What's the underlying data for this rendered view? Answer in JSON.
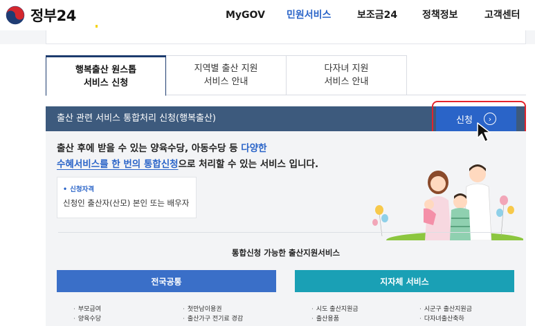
{
  "header": {
    "logo_text": "정부24",
    "nav": [
      "MyGOV",
      "민원서비스",
      "보조금24",
      "정책정보",
      "고객센터"
    ],
    "active_nav": "민원서비스"
  },
  "tabs": [
    {
      "line1": "행복출산 원스톱",
      "line2": "서비스 신청",
      "active": true
    },
    {
      "line1": "지역별 출산 지원",
      "line2": "서비스 안내",
      "active": false
    },
    {
      "line1": "다자녀 지원",
      "line2": "서비스 안내",
      "active": false
    }
  ],
  "service": {
    "title": "출산 관련 서비스 통합처리 신청(행복출산)",
    "apply_label": "신청",
    "lead": {
      "p1": "출산 후에 받을 수 있는 양육수당, 아동수당 등 ",
      "p1_hl": "다양한",
      "p2_hl": "수혜서비스를 한 번의 통합신청",
      "p2": "으로 처리할 수 있는 서비스 입니다."
    },
    "qualification_label": "신청자격",
    "qualification_value": "신청인 출산자(산모) 본인 또는 배우자"
  },
  "list": {
    "title": "통합신청 가능한 출산지원서비스",
    "national": {
      "label": "전국공통",
      "items": [
        "부모급여",
        "양육수당",
        "첫만남이용권",
        "출산가구 전기료 경감"
      ]
    },
    "local": {
      "label": "지자체 서비스",
      "items": [
        "시도 출산지원금",
        "출산용품",
        "시군구 출산지원금",
        "다자녀출산축하"
      ]
    }
  },
  "colors": {
    "accent": "#2a64c8",
    "service_bar": "#3d5a7d",
    "national": "#3a6fc8",
    "local": "#1aa0b5",
    "highlight": "#e4232b"
  }
}
